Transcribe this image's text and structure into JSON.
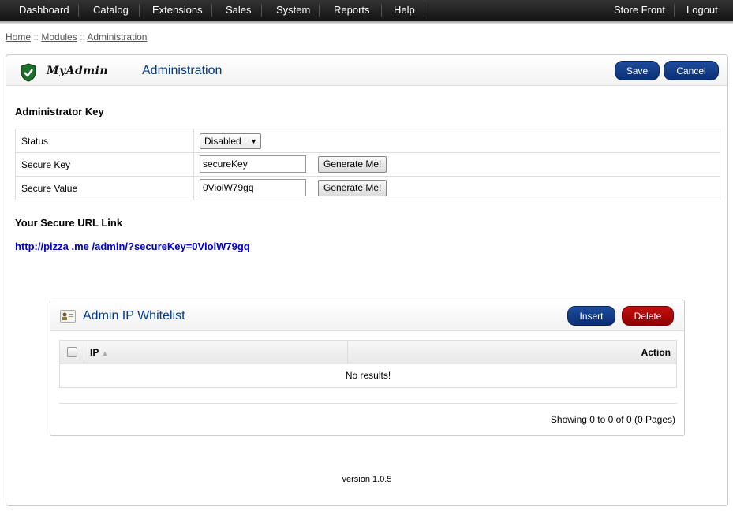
{
  "topnav": {
    "left": [
      "Dashboard",
      "Catalog",
      "Extensions",
      "Sales",
      "System",
      "Reports",
      "Help"
    ],
    "right": [
      "Store Front",
      "Logout"
    ]
  },
  "breadcrumb": {
    "items": [
      "Home",
      "Modules",
      "Administration"
    ],
    "separator": "::"
  },
  "header": {
    "logo_text": "MyAdmin",
    "title": "Administration",
    "save_label": "Save",
    "cancel_label": "Cancel"
  },
  "admin_key": {
    "heading": "Administrator Key",
    "status_label": "Status",
    "status_value": "Disabled",
    "secure_key_label": "Secure Key",
    "secure_key_value": "secureKey",
    "secure_value_label": "Secure Value",
    "secure_value_value": "0VioiW79gq",
    "generate_label": "Generate Me!"
  },
  "secure_url": {
    "heading": "Your Secure URL Link",
    "link": "http://pizza .me /admin/?secureKey=0VioiW79gq"
  },
  "whitelist": {
    "title": "Admin IP Whitelist",
    "insert_label": "Insert",
    "delete_label": "Delete",
    "columns": {
      "ip": "IP",
      "sort_icon": "▲",
      "action": "Action"
    },
    "empty_text": "No results!",
    "pager": "Showing 0 to 0 of 0 (0 Pages)"
  },
  "footer": {
    "version": "version 1.0.5"
  },
  "colors": {
    "brand_blue": "#003a88",
    "button_blue": "#0a2f74",
    "button_red": "#a80000",
    "link_blue": "#0000cc"
  }
}
